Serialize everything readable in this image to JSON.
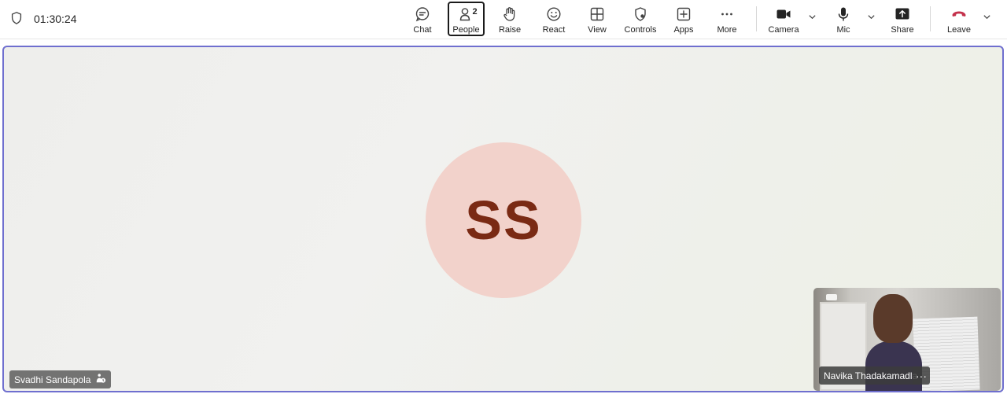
{
  "call": {
    "timer": "01:30:24"
  },
  "toolbar": {
    "chat": "Chat",
    "people": "People",
    "people_count": "2",
    "raise": "Raise",
    "react": "React",
    "view": "View",
    "controls": "Controls",
    "apps": "Apps",
    "more": "More",
    "camera": "Camera",
    "mic": "Mic",
    "share": "Share",
    "leave": "Leave"
  },
  "stage": {
    "avatar_initials": "SS",
    "participant_name": "Svadhi Sandapola"
  },
  "self_view": {
    "name": "Navika Thadakamadla",
    "more_label": "···"
  },
  "colors": {
    "accent_border": "#6f6fcf",
    "avatar_bg": "#f2d2cb",
    "avatar_text": "#7a2a14",
    "leave_red": "#c4314b"
  },
  "icons": {
    "timer": "shield-icon",
    "chat": "chat-bubble-icon",
    "people": "people-icon",
    "raise": "raise-hand-icon",
    "react": "smiley-icon",
    "view": "grid-view-icon",
    "controls": "shield-gear-icon",
    "apps": "plus-square-icon",
    "more": "ellipsis-icon",
    "camera": "video-camera-icon",
    "mic": "microphone-icon",
    "share": "share-screen-icon",
    "leave": "phone-hangup-icon",
    "participant_status": "hand-status-icon"
  }
}
